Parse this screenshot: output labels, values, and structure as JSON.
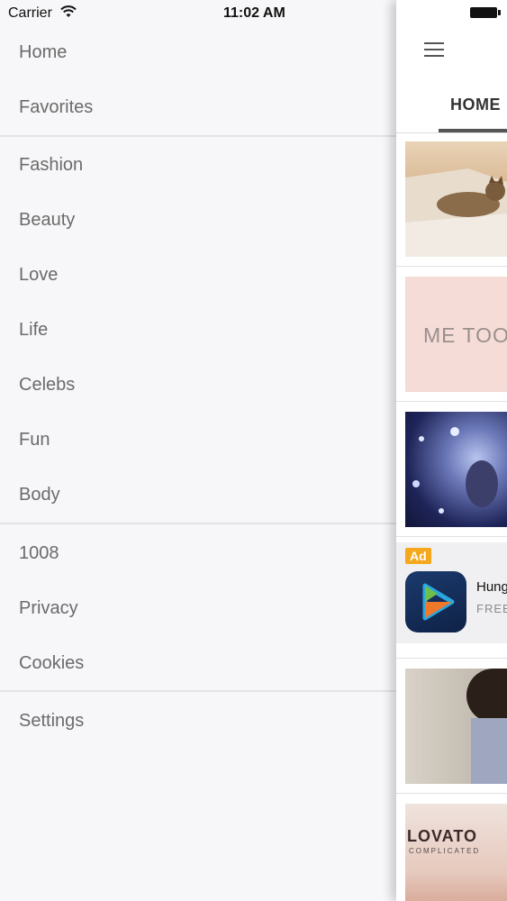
{
  "status_bar": {
    "carrier": "Carrier",
    "time": "11:02 AM"
  },
  "drawer": {
    "groups": [
      [
        "Home",
        "Favorites"
      ],
      [
        "Fashion",
        "Beauty",
        "Love",
        "Life",
        "Celebs",
        "Fun",
        "Body"
      ],
      [
        "1008",
        "Privacy",
        "Cookies"
      ],
      [
        "Settings"
      ]
    ]
  },
  "panel": {
    "tab": "HOME",
    "cards": {
      "metoo_text": "ME TOO.",
      "lovato_title": "LOVATO",
      "lovato_sub": "COMPLICATED"
    },
    "ad": {
      "badge": "Ad",
      "title": "Hung",
      "subtitle": "FREE"
    }
  },
  "colors": {
    "ad_badge": "#f5a81c",
    "drawer_bg": "#f7f6f8",
    "menu_text": "#6b6b6b"
  }
}
